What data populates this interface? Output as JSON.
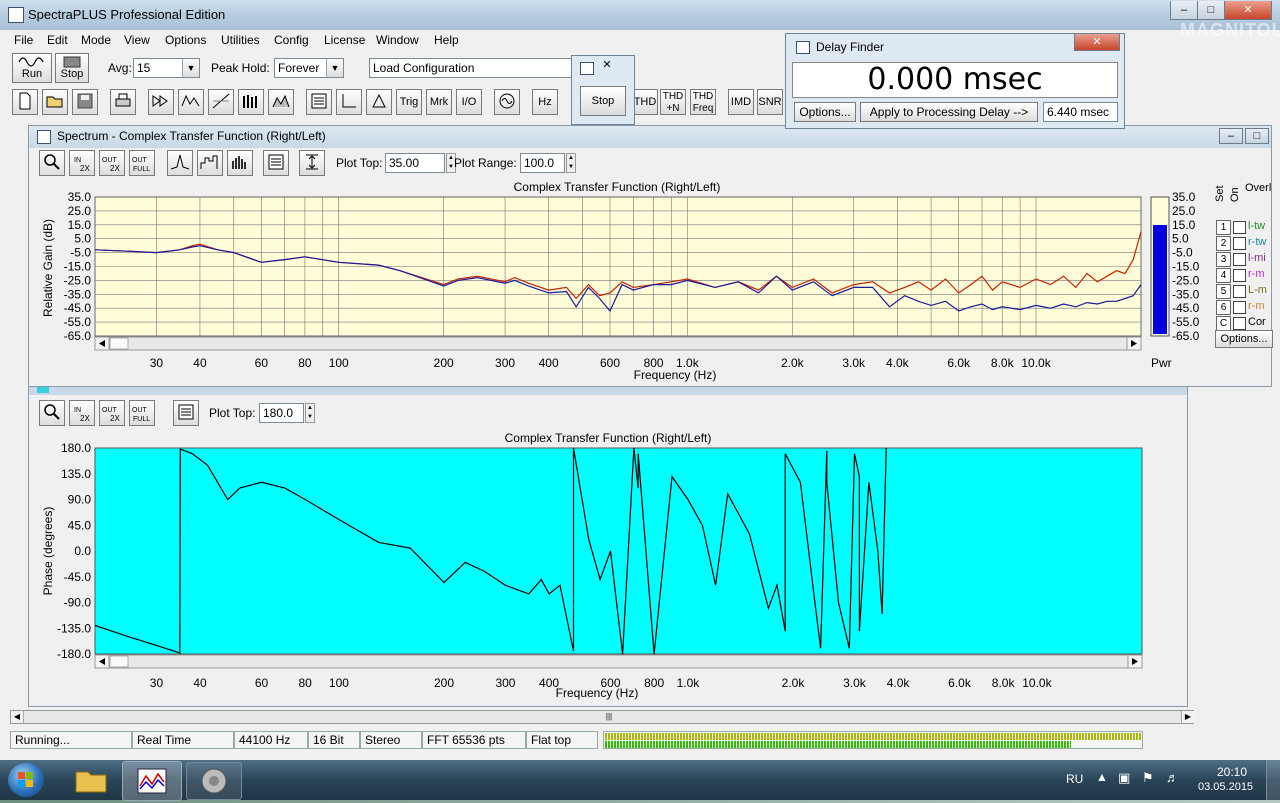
{
  "app": {
    "title": "SpectraPLUS Professional Edition"
  },
  "menu": [
    "File",
    "Edit",
    "Mode",
    "View",
    "Options",
    "Utilities",
    "Config",
    "License",
    "Window",
    "Help"
  ],
  "toolbar": {
    "run_label": "Run",
    "stop_label": "Stop",
    "avg_label": "Avg:",
    "avg_value": "15",
    "peak_label": "Peak Hold:",
    "peak_value": "Forever",
    "config_value": "Load Configuration",
    "row2": [
      "Trig",
      "Mrk",
      "I/O",
      "Hz",
      "THD",
      "THD +N",
      "THD Freq",
      "IMD",
      "SNR"
    ]
  },
  "stop_window": {
    "button": "Stop"
  },
  "delay_finder": {
    "title": "Delay Finder",
    "readout": "0.000 msec",
    "options_btn": "Options...",
    "apply_btn": "Apply to Processing Delay -->",
    "value": "6.440 msec"
  },
  "spectrum": {
    "window_title": "Spectrum - Complex Transfer Function (Right/Left)",
    "plot_top_label": "Plot Top:",
    "plot_top_value": "35.00",
    "plot_range_label": "Plot Range:",
    "plot_range_value": "100.0",
    "chart_title": "Complex Transfer Function (Right/Left)",
    "ylabel": "Relative Gain (dB)",
    "xlabel": "Frequency (Hz)",
    "pwr_label": "Pwr",
    "overlay_header": "Overl",
    "set_label": "Set",
    "on_label": "On",
    "overlays": [
      {
        "num": "1",
        "name": "l-tw",
        "color": "#2a8a2a"
      },
      {
        "num": "2",
        "name": "r-tw",
        "color": "#1a8aa8"
      },
      {
        "num": "3",
        "name": "l-mi",
        "color": "#8a2a8a"
      },
      {
        "num": "4",
        "name": "r-m",
        "color": "#c02ac0"
      },
      {
        "num": "5",
        "name": "L-m",
        "color": "#7a6a1a"
      },
      {
        "num": "6",
        "name": "r-m",
        "color": "#d08030"
      },
      {
        "num": "C",
        "name": "Cor",
        "color": "#000000"
      }
    ],
    "options_btn": "Options..."
  },
  "phase": {
    "plot_top_label": "Plot Top:",
    "plot_top_value": "180.0",
    "chart_title": "Complex Transfer Function (Right/Left)",
    "ylabel": "Phase (degrees)",
    "xlabel": "Frequency (Hz)"
  },
  "status": [
    "Running...",
    "Real Time",
    "44100 Hz",
    "16 Bit",
    "Stereo",
    "FFT 65536 pts",
    "Flat top"
  ],
  "taskbar": {
    "lang": "RU",
    "time": "20:10",
    "date": "03.05.2015"
  },
  "watermark": "MAGNITOLA",
  "chart_data": [
    {
      "type": "line",
      "title": "Complex Transfer Function (Right/Left)",
      "xlabel": "Frequency (Hz)",
      "ylabel": "Relative Gain (dB)",
      "x_scale": "log",
      "xlim": [
        20,
        20000
      ],
      "ylim": [
        -65,
        35
      ],
      "yticks": [
        35,
        25,
        15,
        5,
        -5,
        -15,
        -25,
        -35,
        -45,
        -55,
        -65
      ],
      "xticks": [
        {
          "v": 30,
          "l": "30"
        },
        {
          "v": 40,
          "l": "40"
        },
        {
          "v": 60,
          "l": "60"
        },
        {
          "v": 80,
          "l": "80"
        },
        {
          "v": 100,
          "l": "100"
        },
        {
          "v": 200,
          "l": "200"
        },
        {
          "v": 300,
          "l": "300"
        },
        {
          "v": 400,
          "l": "400"
        },
        {
          "v": 600,
          "l": "600"
        },
        {
          "v": 800,
          "l": "800"
        },
        {
          "v": 1000,
          "l": "1.0k"
        },
        {
          "v": 2000,
          "l": "2.0k"
        },
        {
          "v": 3000,
          "l": "3.0k"
        },
        {
          "v": 4000,
          "l": "4.0k"
        },
        {
          "v": 6000,
          "l": "6.0k"
        },
        {
          "v": 8000,
          "l": "8.0k"
        },
        {
          "v": 10000,
          "l": "10.0k"
        }
      ],
      "grid": true,
      "series": [
        {
          "color": "#cc2200",
          "x": [
            20,
            25,
            30,
            35,
            38,
            40,
            45,
            50,
            60,
            70,
            80,
            100,
            130,
            150,
            200,
            220,
            250,
            300,
            320,
            350,
            400,
            450,
            480,
            520,
            560,
            600,
            650,
            700,
            800,
            900,
            1000,
            1200,
            1400,
            1600,
            1800,
            2000,
            2300,
            2600,
            3000,
            3400,
            3800,
            4200,
            4600,
            5000,
            5500,
            6000,
            6500,
            7000,
            7500,
            8000,
            9000,
            10000,
            11000,
            12000,
            13000,
            14000,
            15000,
            16000,
            17000,
            18000,
            19000,
            20000
          ],
          "y": [
            -3,
            -4,
            -5,
            -3,
            0,
            1,
            -3,
            -5,
            -12,
            -10,
            -8,
            -12,
            -14,
            -18,
            -28,
            -24,
            -22,
            -26,
            -23,
            -27,
            -32,
            -30,
            -38,
            -28,
            -36,
            -34,
            -26,
            -30,
            -28,
            -26,
            -24,
            -30,
            -26,
            -32,
            -22,
            -30,
            -24,
            -34,
            -28,
            -26,
            -34,
            -30,
            -26,
            -32,
            -24,
            -34,
            -28,
            -22,
            -32,
            -26,
            -30,
            -24,
            -28,
            -22,
            -30,
            -20,
            -26,
            -22,
            -18,
            -20,
            -10,
            10
          ]
        },
        {
          "color": "#1a1aa0",
          "x": [
            20,
            25,
            30,
            35,
            38,
            40,
            45,
            50,
            60,
            70,
            80,
            100,
            130,
            150,
            200,
            220,
            250,
            300,
            320,
            350,
            400,
            450,
            480,
            520,
            560,
            600,
            650,
            700,
            800,
            900,
            1000,
            1200,
            1400,
            1600,
            1800,
            2000,
            2300,
            2600,
            3000,
            3400,
            3800,
            4200,
            4600,
            5000,
            5500,
            6000,
            6500,
            7000,
            7500,
            8000,
            9000,
            10000,
            11000,
            12000,
            13000,
            14000,
            15000,
            16000,
            17000,
            18000,
            19000,
            20000
          ],
          "y": [
            -3,
            -4,
            -5,
            -3,
            -1,
            0,
            -3,
            -5,
            -12,
            -10,
            -8,
            -12,
            -14,
            -18,
            -29,
            -25,
            -23,
            -27,
            -25,
            -29,
            -34,
            -33,
            -44,
            -30,
            -38,
            -47,
            -28,
            -32,
            -28,
            -28,
            -25,
            -30,
            -26,
            -34,
            -22,
            -32,
            -26,
            -36,
            -30,
            -30,
            -44,
            -36,
            -40,
            -43,
            -40,
            -47,
            -44,
            -42,
            -46,
            -44,
            -46,
            -43,
            -45,
            -42,
            -44,
            -41,
            -42,
            -40,
            -40,
            -38,
            -36,
            -28
          ]
        }
      ]
    },
    {
      "type": "line",
      "title": "Complex Transfer Function (Right/Left)",
      "xlabel": "Frequency (Hz)",
      "ylabel": "Phase (degrees)",
      "x_scale": "log",
      "xlim": [
        20,
        20000
      ],
      "ylim": [
        -180,
        180
      ],
      "yticks": [
        180,
        135,
        90,
        45,
        0,
        -45,
        -90,
        -135,
        -180
      ],
      "xticks": [
        {
          "v": 30,
          "l": "30"
        },
        {
          "v": 40,
          "l": "40"
        },
        {
          "v": 60,
          "l": "60"
        },
        {
          "v": 80,
          "l": "80"
        },
        {
          "v": 100,
          "l": "100"
        },
        {
          "v": 200,
          "l": "200"
        },
        {
          "v": 300,
          "l": "300"
        },
        {
          "v": 400,
          "l": "400"
        },
        {
          "v": 600,
          "l": "600"
        },
        {
          "v": 800,
          "l": "800"
        },
        {
          "v": 1000,
          "l": "1.0k"
        },
        {
          "v": 2000,
          "l": "2.0k"
        },
        {
          "v": 3000,
          "l": "3.0k"
        },
        {
          "v": 4000,
          "l": "4.0k"
        },
        {
          "v": 6000,
          "l": "6.0k"
        },
        {
          "v": 8000,
          "l": "8.0k"
        },
        {
          "v": 10000,
          "l": "10.0k"
        }
      ],
      "grid": false,
      "series": [
        {
          "color": "#000000",
          "x": [
            20,
            25,
            30,
            35,
            35.1,
            38,
            42,
            48,
            52,
            60,
            70,
            80,
            100,
            130,
            160,
            200,
            230,
            260,
            300,
            350,
            380,
            400,
            430,
            470,
            470.1,
            520,
            560,
            600,
            650,
            700,
            720,
            720.1,
            800,
            900,
            1000,
            1100,
            1200,
            1300,
            1500,
            1700,
            1800,
            1900,
            1900.1,
            2100,
            2300,
            2400,
            2500,
            2500.1,
            2700,
            2900,
            3000,
            3100,
            3100.1,
            3300,
            3500,
            3600,
            3700
          ],
          "y": [
            -130,
            -150,
            -165,
            -178,
            178,
            170,
            150,
            90,
            110,
            120,
            110,
            90,
            55,
            15,
            5,
            -55,
            -20,
            -35,
            -60,
            -75,
            -50,
            -75,
            -60,
            -175,
            180,
            20,
            -50,
            0,
            -180,
            180,
            110,
            170,
            -180,
            130,
            90,
            45,
            -60,
            100,
            30,
            -100,
            -60,
            -140,
            170,
            120,
            -80,
            -170,
            175,
            120,
            -90,
            -170,
            170,
            130,
            -140,
            120,
            0,
            -110,
            180
          ]
        }
      ]
    }
  ]
}
